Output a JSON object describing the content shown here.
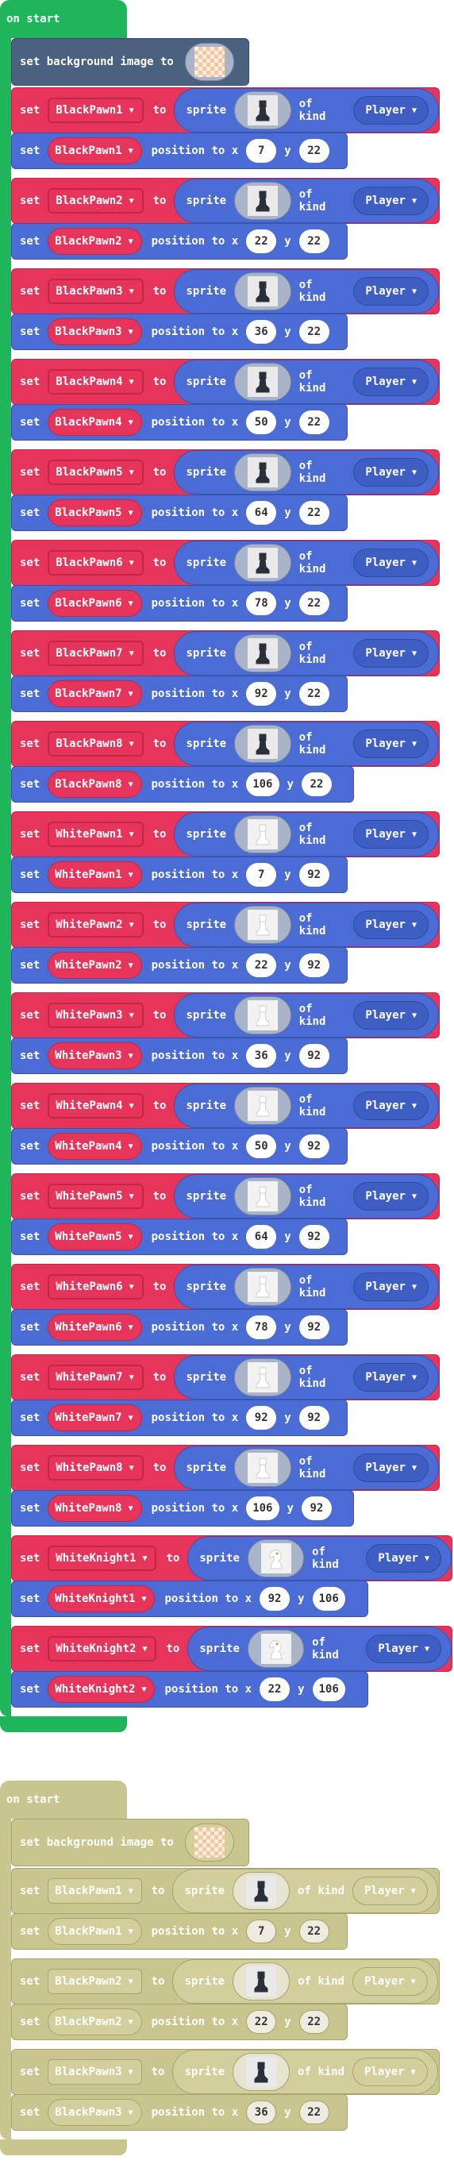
{
  "event_label": "on start",
  "bg_block": {
    "set": "set background image to"
  },
  "words": {
    "set": "set",
    "to": "to",
    "sprite": "sprite",
    "of_kind": "of kind",
    "position_to_x": "position to x",
    "y": "y"
  },
  "kind_value": "Player",
  "colors": {
    "event": "#1fb55b",
    "sprite_block": "#e6345a",
    "position_block": "#4a6cd4",
    "scene_block": "#4b6180",
    "disabled": "#c8c58f"
  },
  "stack1": [
    {
      "var": "BlackPawn1",
      "piece": "black-pawn",
      "x": "7",
      "y": "22"
    },
    {
      "var": "BlackPawn2",
      "piece": "black-pawn",
      "x": "22",
      "y": "22"
    },
    {
      "var": "BlackPawn3",
      "piece": "black-pawn",
      "x": "36",
      "y": "22"
    },
    {
      "var": "BlackPawn4",
      "piece": "black-pawn",
      "x": "50",
      "y": "22"
    },
    {
      "var": "BlackPawn5",
      "piece": "black-pawn",
      "x": "64",
      "y": "22"
    },
    {
      "var": "BlackPawn6",
      "piece": "black-pawn",
      "x": "78",
      "y": "22"
    },
    {
      "var": "BlackPawn7",
      "piece": "black-pawn",
      "x": "92",
      "y": "22"
    },
    {
      "var": "BlackPawn8",
      "piece": "black-pawn",
      "x": "106",
      "y": "22"
    },
    {
      "var": "WhitePawn1",
      "piece": "white-pawn",
      "x": "7",
      "y": "92"
    },
    {
      "var": "WhitePawn2",
      "piece": "white-pawn",
      "x": "22",
      "y": "92"
    },
    {
      "var": "WhitePawn3",
      "piece": "white-pawn",
      "x": "36",
      "y": "92"
    },
    {
      "var": "WhitePawn4",
      "piece": "white-pawn",
      "x": "50",
      "y": "92"
    },
    {
      "var": "WhitePawn5",
      "piece": "white-pawn",
      "x": "64",
      "y": "92"
    },
    {
      "var": "WhitePawn6",
      "piece": "white-pawn",
      "x": "78",
      "y": "92"
    },
    {
      "var": "WhitePawn7",
      "piece": "white-pawn",
      "x": "92",
      "y": "92"
    },
    {
      "var": "WhitePawn8",
      "piece": "white-pawn",
      "x": "106",
      "y": "92"
    },
    {
      "var": "WhiteKnight1",
      "piece": "white-knight",
      "x": "92",
      "y": "106"
    },
    {
      "var": "WhiteKnight2",
      "piece": "white-knight",
      "x": "22",
      "y": "106"
    }
  ],
  "stack2": [
    {
      "var": "BlackPawn1",
      "piece": "black-pawn",
      "x": "7",
      "y": "22"
    },
    {
      "var": "BlackPawn2",
      "piece": "black-pawn",
      "x": "22",
      "y": "22"
    },
    {
      "var": "BlackPawn3",
      "piece": "black-pawn",
      "x": "36",
      "y": "22"
    }
  ]
}
